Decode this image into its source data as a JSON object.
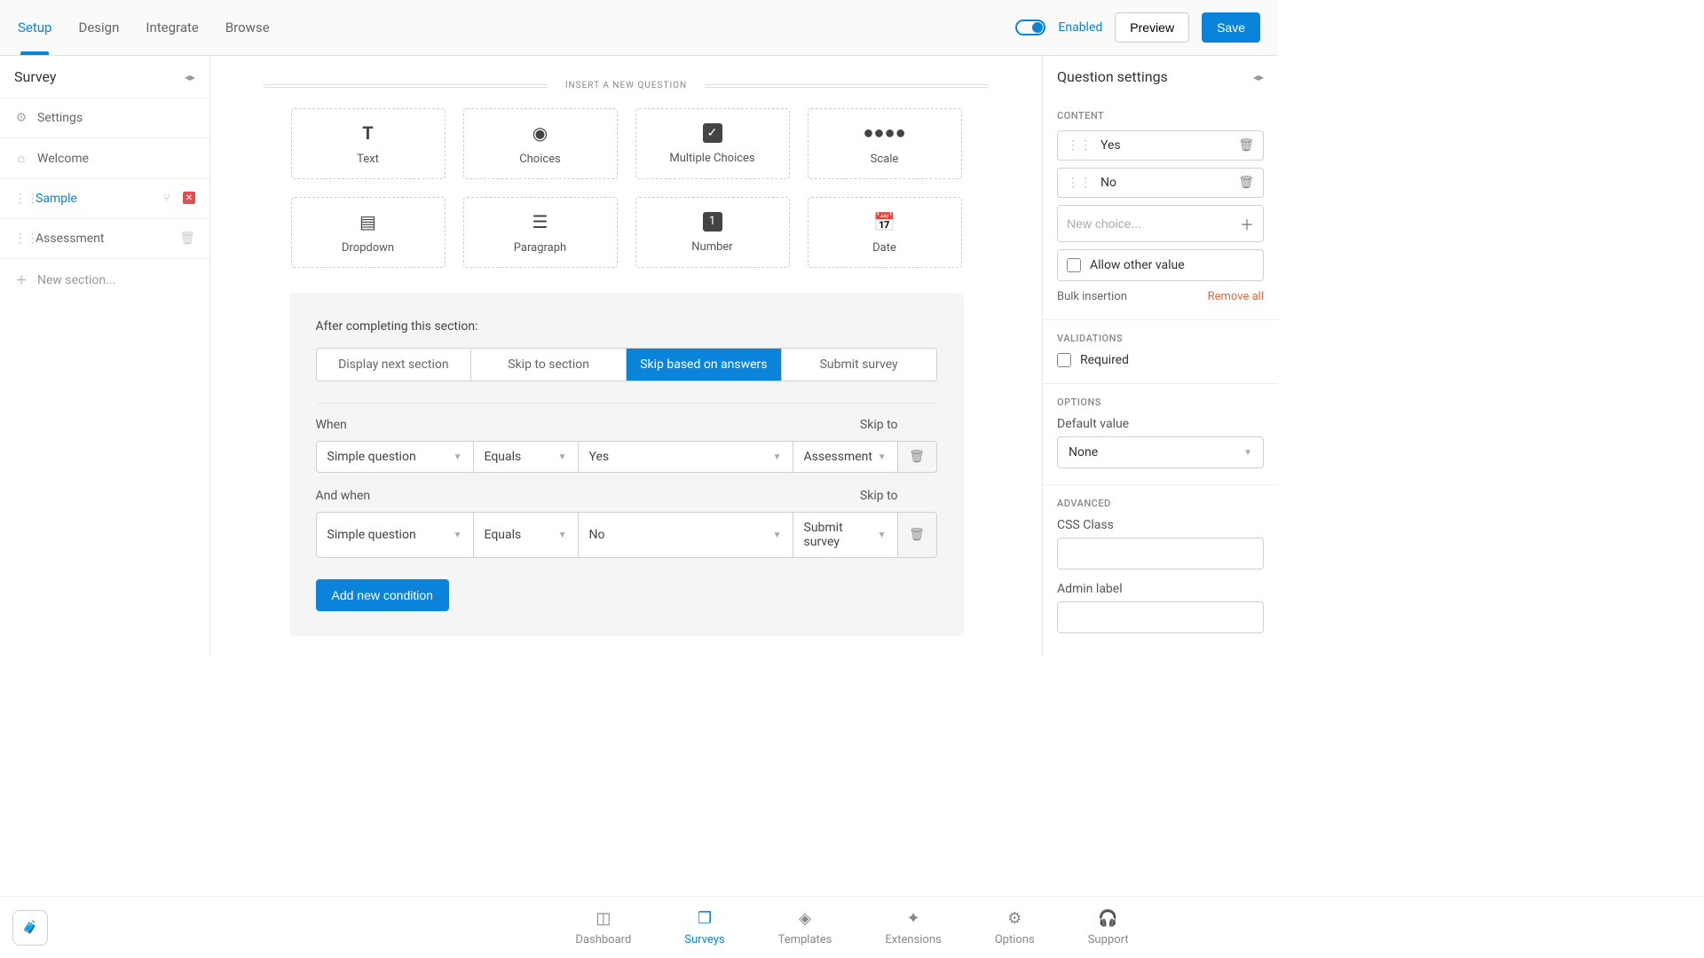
{
  "topTabs": {
    "setup": "Setup",
    "design": "Design",
    "integrate": "Integrate",
    "browse": "Browse"
  },
  "topActions": {
    "enabled": "Enabled",
    "preview": "Preview",
    "save": "Save"
  },
  "leftPanel": {
    "title": "Survey",
    "settings": "Settings",
    "welcome": "Welcome",
    "sample": "Sample",
    "assessment": "Assessment",
    "newSection": "New section..."
  },
  "insert": {
    "header": "INSERT A NEW QUESTION",
    "types": {
      "text": "Text",
      "choices": "Choices",
      "multiple": "Multiple Choices",
      "scale": "Scale",
      "dropdown": "Dropdown",
      "paragraph": "Paragraph",
      "number": "Number",
      "date": "Date"
    }
  },
  "completion": {
    "title": "After completing this section:",
    "tabs": {
      "displayNext": "Display next section",
      "skipTo": "Skip to section",
      "skipAnswers": "Skip based on answers",
      "submit": "Submit survey"
    },
    "labels": {
      "when": "When",
      "andWhen": "And when",
      "skipTo": "Skip to"
    },
    "rule1": {
      "question": "Simple question",
      "op": "Equals",
      "value": "Yes",
      "target": "Assessment"
    },
    "rule2": {
      "question": "Simple question",
      "op": "Equals",
      "value": "No",
      "target": "Submit survey"
    },
    "addButton": "Add new condition"
  },
  "rightPanel": {
    "title": "Question settings",
    "contentHeader": "Content",
    "choices": {
      "c0": "Yes",
      "c1": "No"
    },
    "newChoicePlaceholder": "New choice...",
    "allowOther": "Allow other value",
    "bulk": "Bulk insertion",
    "removeAll": "Remove all",
    "validationsHeader": "Validations",
    "required": "Required",
    "optionsHeader": "Options",
    "defaultLabel": "Default value",
    "defaultValue": "None",
    "advancedHeader": "Advanced",
    "cssLabel": "CSS Class",
    "adminLabel": "Admin label"
  },
  "bottomNav": {
    "dashboard": "Dashboard",
    "surveys": "Surveys",
    "templates": "Templates",
    "extensions": "Extensions",
    "options": "Options",
    "support": "Support"
  }
}
